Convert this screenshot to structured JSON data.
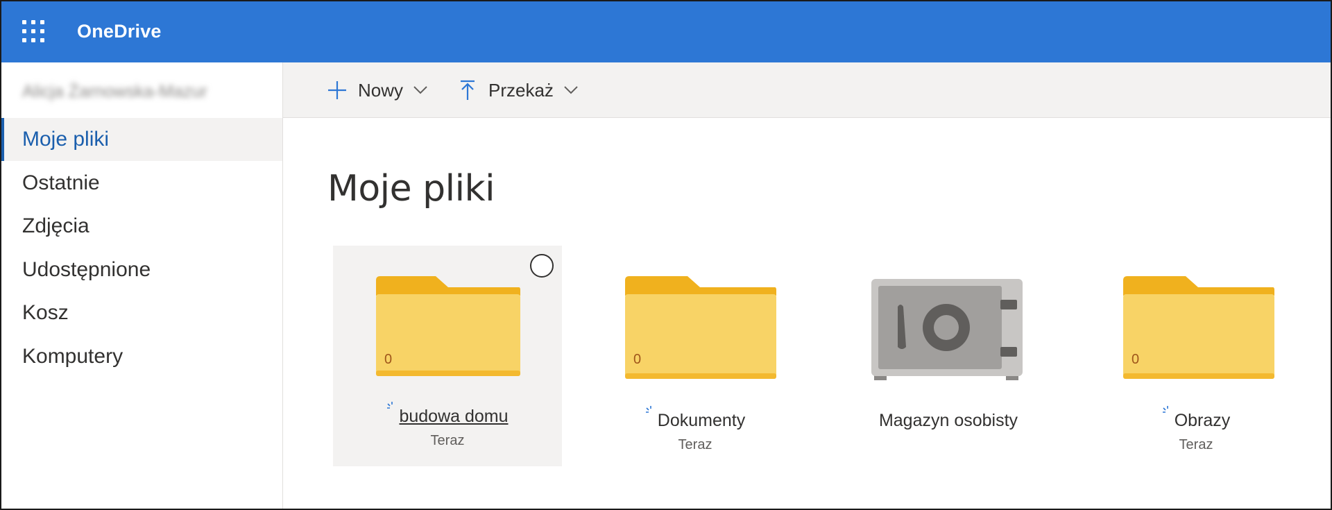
{
  "header": {
    "app_title": "OneDrive",
    "accent_color": "#2d77d5",
    "waffle_icon": "app-launcher-icon"
  },
  "sidebar": {
    "user_name": "Alicja Żarnowska-Mazur",
    "items": [
      {
        "label": "Moje pliki",
        "active": true
      },
      {
        "label": "Ostatnie"
      },
      {
        "label": "Zdjęcia"
      },
      {
        "label": "Udostępnione"
      },
      {
        "label": "Kosz"
      },
      {
        "label": "Komputery"
      }
    ]
  },
  "toolbar": {
    "new_label": "Nowy",
    "new_icon": "plus-icon",
    "upload_label": "Przekaż",
    "upload_icon": "upload-arrow-icon"
  },
  "main": {
    "title": "Moje pliki",
    "items": [
      {
        "name": "budowa domu",
        "date": "Teraz",
        "type": "folder",
        "count": "0",
        "selected": true,
        "syncing": true
      },
      {
        "name": "Dokumenty",
        "date": "Teraz",
        "type": "folder",
        "count": "0",
        "syncing": true
      },
      {
        "name": "Magazyn osobisty",
        "date": "",
        "type": "vault"
      },
      {
        "name": "Obrazy",
        "date": "Teraz",
        "type": "folder",
        "count": "0",
        "syncing": true
      }
    ]
  }
}
